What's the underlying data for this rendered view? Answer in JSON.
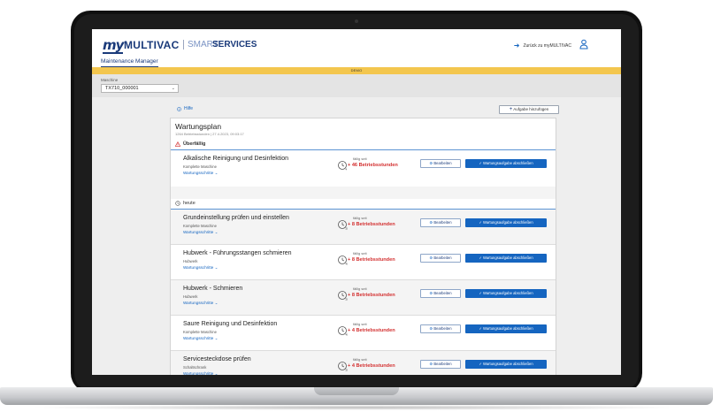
{
  "app": {
    "logo_my": "my",
    "logo_brand": "MULTIVAC",
    "logo_smart": "SMART",
    "logo_services": "SERVICES",
    "nav_back": "Zurück zu myMULTIVAC",
    "tab": "Maintenance Manager",
    "demo_banner": "DEMO"
  },
  "machine": {
    "label": "Maschine",
    "selected": "TX710_000001"
  },
  "toolbar": {
    "info": "Hilfe",
    "add_task": "Aufgabe hinzufügen"
  },
  "plan": {
    "title": "Wartungsplan",
    "subtitle": "1264 Betriebsstunden | 27.4.2023, 09:03:17"
  },
  "groups": {
    "overdue": "Überfällig",
    "today": "heute"
  },
  "task_common": {
    "steps_link": "Wartungsschritte",
    "due_label": "fällig seit",
    "edit": "Bearbeiten",
    "complete": "Wartungsaufgabe abschließen"
  },
  "tasks": [
    {
      "title": "Alkalische Reinigung und Desinfektion",
      "scope": "Komplette Maschine",
      "due": "+ 46 Betriebsstunden",
      "clock_label": "4"
    },
    {
      "title": "Grundeinstellung prüfen und einstellen",
      "scope": "Komplette Maschine",
      "due": "+ 8 Betriebsstunden",
      "clock_label": "200"
    },
    {
      "title": "Hubwerk - Führungsstangen schmieren",
      "scope": "Hubwerk",
      "due": "+ 8 Betriebsstunden",
      "clock_label": "40"
    },
    {
      "title": "Hubwerk - Schmieren",
      "scope": "Hubwerk",
      "due": "+ 8 Betriebsstunden",
      "clock_label": "200"
    },
    {
      "title": "Saure Reinigung und Desinfektion",
      "scope": "Komplette Maschine",
      "due": "+ 4 Betriebsstunden",
      "clock_label": "40"
    },
    {
      "title": "Servicesteckdose prüfen",
      "scope": "Schaltschrank",
      "due": "+ 4 Betriebsstunden",
      "clock_label": "2000"
    }
  ],
  "colors": {
    "brand": "#1a3a7a",
    "accent": "#1565c0",
    "demo": "#f3c64e",
    "overdue": "#d32f2f"
  }
}
